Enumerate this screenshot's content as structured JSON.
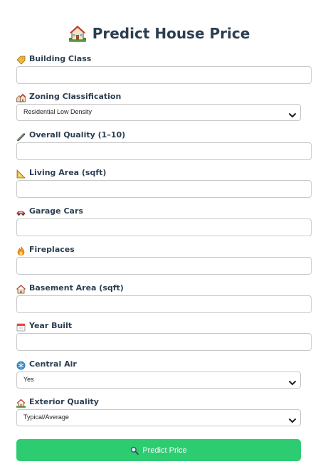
{
  "header": {
    "title": "Predict House Price",
    "icon": "house-with-garden-icon"
  },
  "fields": [
    {
      "id": "building_class",
      "label": "Building Class",
      "icon": "tag-icon",
      "type": "text",
      "value": ""
    },
    {
      "id": "zoning",
      "label": "Zoning Classification",
      "icon": "houses-icon",
      "type": "select",
      "value": "Residential Low Density"
    },
    {
      "id": "overall_quality",
      "label": "Overall Quality (1–10)",
      "icon": "pen-icon",
      "type": "text",
      "value": ""
    },
    {
      "id": "living_area",
      "label": "Living Area (sqft)",
      "icon": "ruler-icon",
      "type": "text",
      "value": ""
    },
    {
      "id": "garage_cars",
      "label": "Garage Cars",
      "icon": "car-icon",
      "type": "text",
      "value": ""
    },
    {
      "id": "fireplaces",
      "label": "Fireplaces",
      "icon": "fire-icon",
      "type": "text",
      "value": ""
    },
    {
      "id": "basement_area",
      "label": "Basement Area (sqft)",
      "icon": "house-icon",
      "type": "text",
      "value": ""
    },
    {
      "id": "year_built",
      "label": "Year Built",
      "icon": "calendar-icon",
      "type": "text",
      "value": ""
    },
    {
      "id": "central_air",
      "label": "Central Air",
      "icon": "snowflake-icon",
      "type": "select",
      "value": "Yes"
    },
    {
      "id": "exterior_quality",
      "label": "Exterior Quality",
      "icon": "house-with-garden-icon",
      "type": "select",
      "value": "Typical/Average"
    }
  ],
  "button": {
    "label": "Predict Price",
    "icon": "magnifier-icon",
    "color": "#2ecc71"
  },
  "colors": {
    "text": "#2c3e50",
    "border": "#c8c8c8",
    "background": "#ffffff"
  }
}
